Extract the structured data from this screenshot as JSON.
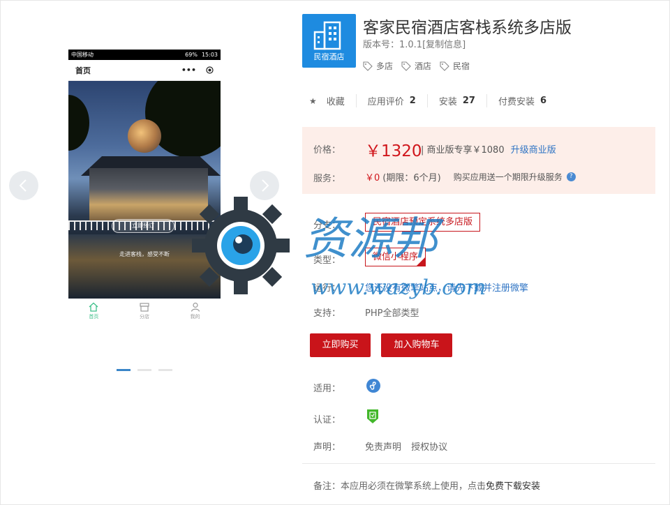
{
  "carousel": {
    "prev_icon": "chevron-left-icon",
    "next_icon": "chevron-right-icon",
    "slide_count": 3,
    "active_slide": 1,
    "phone": {
      "carrier": "中国移动",
      "battery": "69%",
      "time": "15:03",
      "page_title": "首页",
      "menu_glyph": "•••",
      "cta_label": "立即预订",
      "tagline": "走进客栈，感受不断",
      "tabs": [
        {
          "label": "首页",
          "icon": "home-icon",
          "active": true
        },
        {
          "label": "分店",
          "icon": "store-icon",
          "active": false
        },
        {
          "label": "我的",
          "icon": "user-icon",
          "active": false
        }
      ]
    }
  },
  "app": {
    "logo_text": "民宿酒店",
    "title": "客家民宿酒店客栈系统多店版",
    "version": "版本号：1.0.1[复制信息]",
    "tags": [
      "多店",
      "酒店",
      "民宿"
    ]
  },
  "stats": {
    "favorite_label": "收藏",
    "review_label": "应用评价",
    "review_count": "2",
    "install_label": "安装",
    "install_count": "27",
    "paid_install_label": "付费安装",
    "paid_install_count": "6"
  },
  "pricing": {
    "price_label": "价格：",
    "price": "￥1320",
    "commercial_text": "| 商业版专享￥1080",
    "upgrade_link": "升级商业版",
    "service_label": "服务：",
    "service_price": "￥0",
    "service_period": "(期限：6个月)",
    "service_desc": "购买应用送一个期限升级服务",
    "help_glyph": "?"
  },
  "options": {
    "branch_label": "分支：",
    "branch_value": "民宿酒店预定系统多店版",
    "type_label": "类型：",
    "type_value": "微信小程序",
    "env_label": "运行：",
    "env_link": "您还没有微擎站点，请先下载并注册微擎",
    "support_label": "支持：",
    "support_value": "PHP全部类型"
  },
  "actions": {
    "buy_label": "立即购买",
    "cart_label": "加入购物车"
  },
  "meta": {
    "apply_label": "适用：",
    "apply_icon": "mini-program-icon",
    "cert_label": "认证：",
    "cert_icon": "certified-shield-icon",
    "legal_label": "声明：",
    "disclaimer_link": "免责声明",
    "license_link": "授权协议",
    "note_prefix": "备注：本应用必须在微擎系统上使用，点击",
    "note_link": "免费下载安装"
  },
  "watermark": {
    "brand_text": "资源邦",
    "url_text": "www.wazyb.com"
  },
  "colors": {
    "accent_red": "#c9141a",
    "link_blue": "#2f74c4",
    "logo_blue": "#1e8be0",
    "price_bg": "#fdeee9",
    "tab_active": "#3dbf8a"
  }
}
